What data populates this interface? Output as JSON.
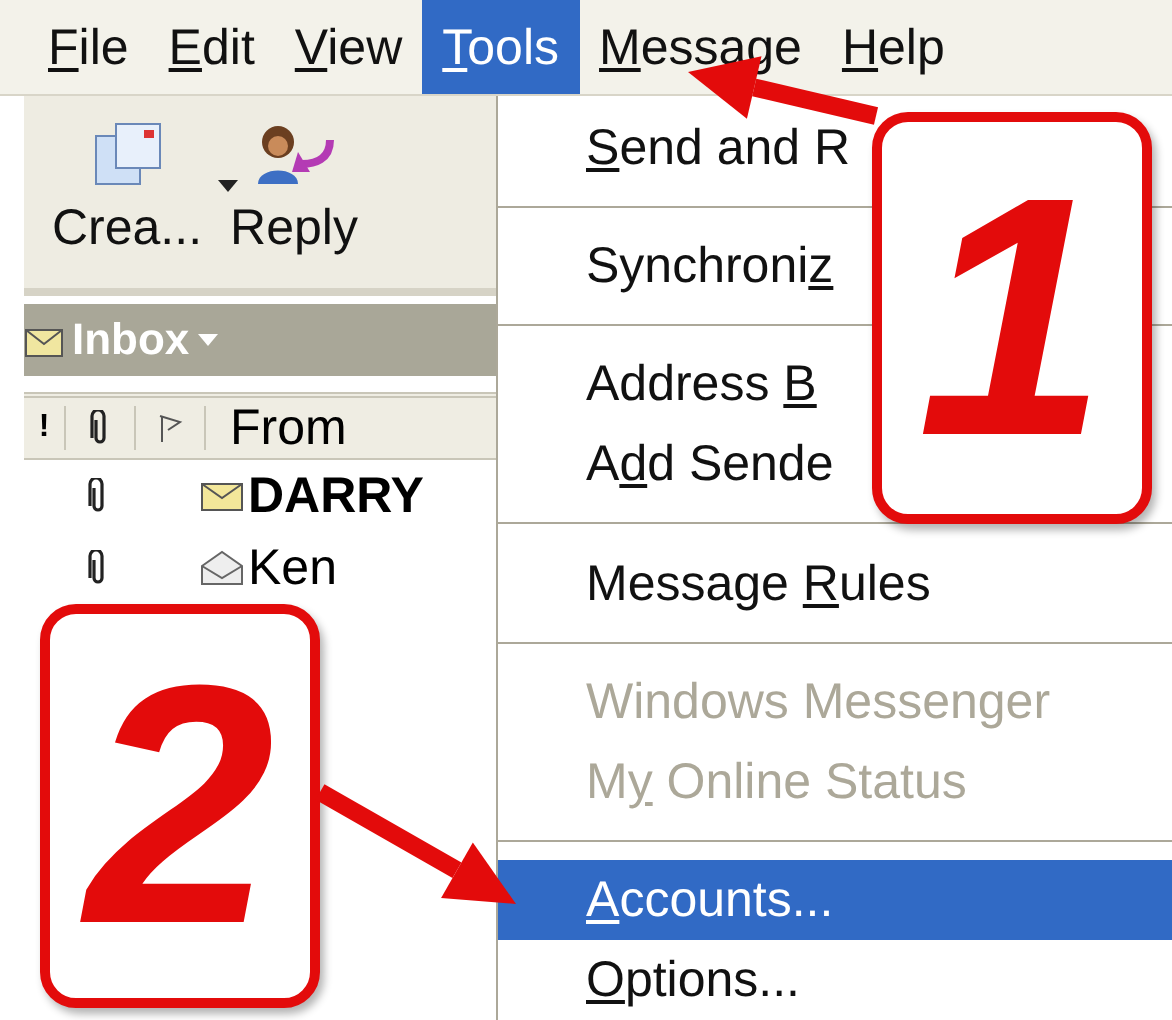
{
  "menu_bar": [
    {
      "key": "F",
      "post": "ile",
      "selected": false
    },
    {
      "key": "E",
      "post": "dit",
      "selected": false
    },
    {
      "key": "V",
      "post": "iew",
      "selected": false
    },
    {
      "key": "T",
      "post": "ools",
      "selected": true
    },
    {
      "key": "M",
      "post": "essage",
      "selected": false
    },
    {
      "key": "H",
      "post": "elp",
      "selected": false
    }
  ],
  "toolbar": [
    {
      "kind": "create",
      "label": "Crea...",
      "dropdown": true
    },
    {
      "kind": "reply",
      "label": "Reply"
    }
  ],
  "folder_bar": {
    "title": "Inbox"
  },
  "message_list": {
    "columns": [
      "!",
      "From"
    ],
    "rows": [
      {
        "from": "DARRY",
        "unread": true,
        "attachment": true
      },
      {
        "from": "Ken",
        "unread": false,
        "attachment": true
      }
    ]
  },
  "tools_menu": [
    {
      "kind": "item",
      "key": "S",
      "post": "end and R",
      "disabled": false,
      "selected": false
    },
    {
      "kind": "separator"
    },
    {
      "kind": "item",
      "pre": "Synchroni",
      "key": "z",
      "disabled": false,
      "selected": false
    },
    {
      "kind": "separator"
    },
    {
      "kind": "item",
      "pre": "Address ",
      "key": "B",
      "disabled": false,
      "selected": false
    },
    {
      "kind": "item",
      "pre": "A",
      "key": "d",
      "post": "d Sende",
      "disabled": false,
      "selected": false
    },
    {
      "kind": "separator"
    },
    {
      "kind": "item",
      "pre": "Message ",
      "key": "R",
      "post": "ules",
      "disabled": false,
      "selected": false
    },
    {
      "kind": "separator"
    },
    {
      "kind": "item",
      "pre": "Windows Messenger",
      "disabled": true,
      "selected": false
    },
    {
      "kind": "item",
      "pre": "M",
      "key": "y",
      "post": " Online Status",
      "disabled": true,
      "selected": false
    },
    {
      "kind": "separator"
    },
    {
      "kind": "item",
      "key": "A",
      "post": "ccounts...",
      "disabled": false,
      "selected": true
    },
    {
      "kind": "item",
      "key": "O",
      "post": "ptions...",
      "disabled": false,
      "selected": false
    }
  ],
  "callouts": [
    {
      "number": "1"
    },
    {
      "number": "2"
    }
  ]
}
